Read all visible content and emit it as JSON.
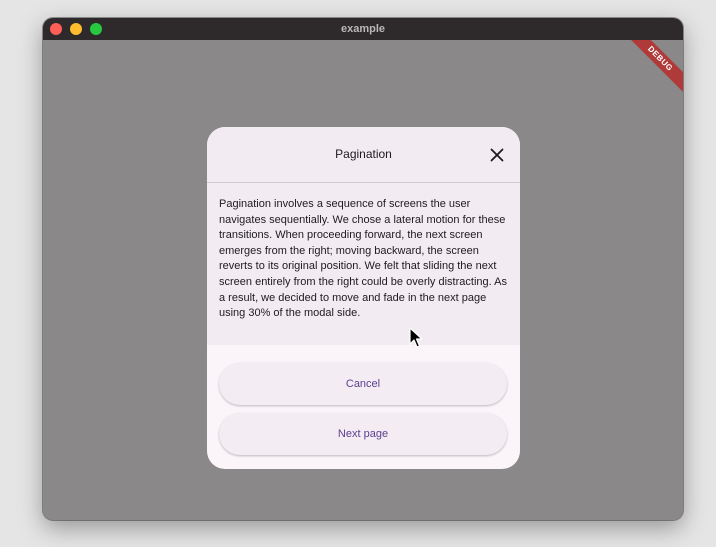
{
  "window": {
    "title": "example"
  },
  "debug_banner": {
    "label": "DEBUG"
  },
  "modal": {
    "title": "Pagination",
    "body": "Pagination involves a sequence of screens the user navigates sequentially. We chose a lateral motion for these transitions. When proceeding forward, the next screen emerges from the right; moving backward, the screen reverts to its original position. We felt that sliding the next screen entirely from the right could be overly distracting. As a result, we decided to move and fade in the next page using 30% of the modal side.",
    "cancel_label": "Cancel",
    "next_label": "Next page"
  },
  "icons": {
    "close": "close-icon",
    "cursor": "mouse-pointer-icon"
  },
  "colors": {
    "accent_text": "#5b3f8f",
    "scrim": "#8a8889",
    "debug_banner": "#b03a3a"
  }
}
